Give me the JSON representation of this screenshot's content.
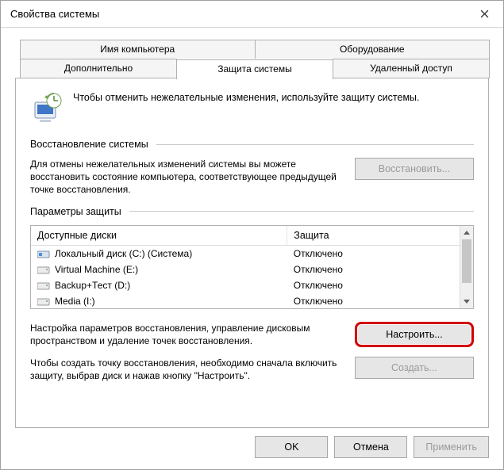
{
  "window": {
    "title": "Свойства системы"
  },
  "tabs": {
    "row1": [
      "Имя компьютера",
      "Оборудование"
    ],
    "row2": [
      "Дополнительно",
      "Защита системы",
      "Удаленный доступ"
    ],
    "active": "Защита системы"
  },
  "intro": "Чтобы отменить нежелательные изменения, используйте защиту системы.",
  "restore": {
    "heading": "Восстановление системы",
    "desc": "Для отмены нежелательных изменений системы вы можете восстановить состояние компьютера, соответствующее предыдущей точке восстановления.",
    "button": "Восстановить..."
  },
  "protection": {
    "heading": "Параметры защиты",
    "columns": {
      "drive": "Доступные диски",
      "status": "Защита"
    },
    "drives": [
      {
        "name": "Локальный диск (C:) (Система)",
        "status": "Отключено",
        "system": true
      },
      {
        "name": "Virtual Machine (E:)",
        "status": "Отключено",
        "system": false
      },
      {
        "name": "Backup+Тест (D:)",
        "status": "Отключено",
        "system": false
      },
      {
        "name": "Media (I:)",
        "status": "Отключено",
        "system": false
      }
    ],
    "configure": {
      "desc": "Настройка параметров восстановления, управление дисковым пространством и удаление точек восстановления.",
      "button": "Настроить..."
    },
    "create": {
      "desc": "Чтобы создать точку восстановления, необходимо сначала включить защиту, выбрав диск и нажав кнопку \"Настроить\".",
      "button": "Создать..."
    }
  },
  "footer": {
    "ok": "OK",
    "cancel": "Отмена",
    "apply": "Применить"
  }
}
